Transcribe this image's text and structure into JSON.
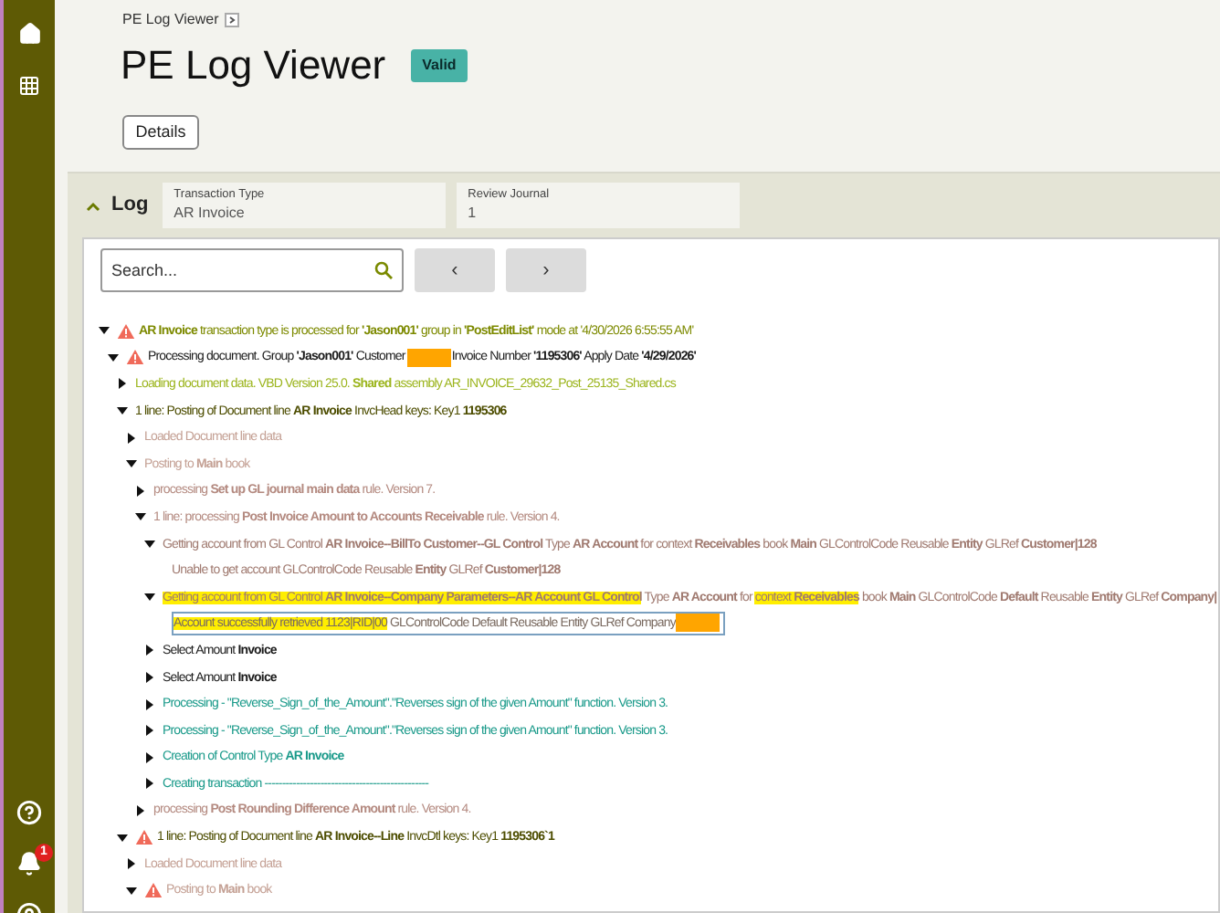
{
  "breadcrumb": "PE Log Viewer",
  "title": "PE Log Viewer",
  "status_badge": "Valid",
  "details_button": "Details",
  "log_panel": {
    "title": "Log",
    "expanded": true,
    "fields": [
      {
        "label": "Transaction Type",
        "value": "AR Invoice"
      },
      {
        "label": "Review Journal",
        "value": "1"
      }
    ]
  },
  "search": {
    "placeholder": "Search..."
  },
  "nav_buttons": [
    "‹",
    "›"
  ],
  "notifications": "1",
  "tree": [
    {
      "expanded": true,
      "warning": true,
      "color": "#7d8a00",
      "text": "**AR Invoice** transaction type is processed for **'Jason001'** group in **'PostEditList'** mode at '4/30/2026 6:55:55 AM'",
      "children": [
        {
          "expanded": true,
          "warning": true,
          "color": "#1a1a1a",
          "parts": [
            {
              "kind": "text",
              "text": "Processing document. Group **'Jason001'** Customer "
            },
            {
              "kind": "redacted"
            },
            {
              "kind": "text",
              "text": "Invoice Number **'1195306'** Apply Date **'4/29/2026'**"
            }
          ],
          "children": [
            {
              "expanded": false,
              "color": "#9cb51e",
              "text": "Loading document data. VBD Version 25.0. **Shared** assembly AR_INVOICE_29632_Post_25135_Shared.cs"
            },
            {
              "expanded": true,
              "color": "#4d4d00",
              "text": "1 line: Posting of Document line **AR Invoice** InvcHead keys: Key1 **1195306**",
              "children": [
                {
                  "expanded": false,
                  "color": "#c4a094",
                  "text": "Loaded Document line data"
                },
                {
                  "expanded": true,
                  "color": "#c4a094",
                  "text": "Posting to **Main** book",
                  "children": [
                    {
                      "expanded": false,
                      "color": "#b48a80",
                      "text": "processing **Set up GL journal main data** rule. Version 7."
                    },
                    {
                      "expanded": true,
                      "color": "#b48a80",
                      "text": "1 line: processing **Post Invoice Amount to Accounts Receivable** rule. Version 4.",
                      "children": [
                        {
                          "expanded": true,
                          "color": "#a07a70",
                          "text": "Getting account from GL Control **AR Invoice--BillTo Customer--GL Control** Type **AR Account** for context **Receivables** book **Main** GLControlCode Reusable **Entity** GLRef **Customer|128**",
                          "children": [
                            {
                              "color": "#a07a70",
                              "text": "Unable to get account GLControlCode Reusable **Entity** GLRef **Customer|128**"
                            }
                          ]
                        },
                        {
                          "expanded": true,
                          "color": "#a07a70",
                          "parts": [
                            {
                              "kind": "text",
                              "highlighted": true,
                              "text": "Getting account from GL Control **AR Invoice--Company Parameters--AR Account GL Control**"
                            },
                            {
                              "kind": "text",
                              "highlighted": false,
                              "text": " Type **AR Account** for "
                            },
                            {
                              "kind": "text",
                              "highlighted": true,
                              "text": "context **Receivables**"
                            },
                            {
                              "kind": "text",
                              "highlighted": false,
                              "text": " book **Main** GLControlCode **Default** Reusable **Entity** GLRef **Company|**"
                            }
                          ],
                          "children": [
                            {
                              "boxed": true,
                              "color": "#7a6a60",
                              "parts": [
                                {
                                  "kind": "text",
                                  "highlighted": true,
                                  "text": "Account successfully retrieved 1123|RID|00"
                                },
                                {
                                  "kind": "text",
                                  "highlighted": false,
                                  "text": " GLControlCode Default Reusable Entity GLRef Company"
                                },
                                {
                                  "kind": "redacted"
                                }
                              ]
                            }
                          ]
                        },
                        {
                          "expanded": false,
                          "color": "#1a1a1a",
                          "text": "Select Amount **Invoice**"
                        },
                        {
                          "expanded": false,
                          "color": "#1a1a1a",
                          "text": "Select Amount **Invoice**"
                        },
                        {
                          "expanded": false,
                          "color": "#1a9a8a",
                          "text": "Processing - \"Reverse_Sign_of_the_Amount\".\"Reverses sign of the given Amount\" function. Version 3."
                        },
                        {
                          "expanded": false,
                          "color": "#1a9a8a",
                          "text": "Processing - \"Reverse_Sign_of_the_Amount\".\"Reverses sign of the given Amount\" function. Version 3."
                        },
                        {
                          "expanded": false,
                          "color": "#1a9a8a",
                          "text": "Creation of Control Type **AR Invoice**"
                        },
                        {
                          "expanded": false,
                          "color": "#1a9a8a",
                          "text": "Creating transaction -----------------------------------------------"
                        }
                      ]
                    },
                    {
                      "expanded": false,
                      "color": "#b48a80",
                      "text": "processing **Post Rounding Difference Amount** rule. Version 4."
                    }
                  ]
                }
              ]
            },
            {
              "expanded": true,
              "warning": true,
              "color": "#4d4d00",
              "text": "1 line: Posting of Document line **AR Invoice--Line** InvcDtl keys: Key1 **1195306`1**",
              "children": [
                {
                  "expanded": false,
                  "color": "#c4a094",
                  "text": "Loaded Document line data"
                },
                {
                  "expanded": true,
                  "warning": true,
                  "color": "#c4a094",
                  "text": "Posting to **Main** book"
                }
              ]
            }
          ]
        }
      ]
    }
  ]
}
